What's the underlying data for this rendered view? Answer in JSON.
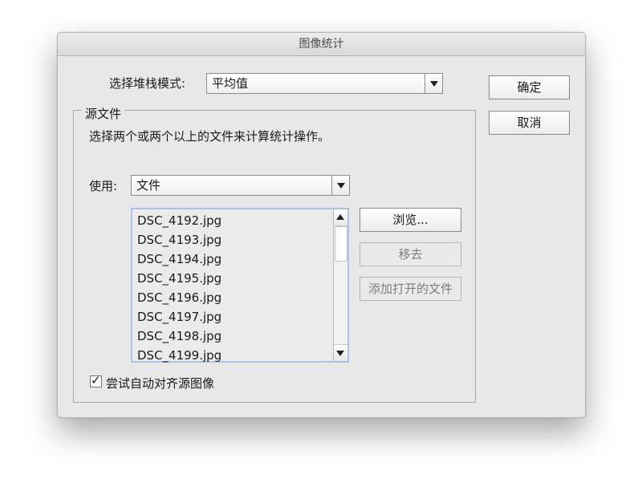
{
  "dialog": {
    "title": "图像统计",
    "stack_mode": {
      "label": "选择堆栈模式:",
      "value": "平均值"
    },
    "source": {
      "group_label": "源文件",
      "description": "选择两个或两个以上的文件来计算统计操作。",
      "use": {
        "label": "使用:",
        "value": "文件"
      },
      "files": [
        "DSC_4192.jpg",
        "DSC_4193.jpg",
        "DSC_4194.jpg",
        "DSC_4195.jpg",
        "DSC_4196.jpg",
        "DSC_4197.jpg",
        "DSC_4198.jpg",
        "DSC_4199.jpg"
      ],
      "buttons": {
        "browse": "浏览...",
        "remove": "移去",
        "add_open": "添加打开的文件"
      },
      "align": {
        "label": "尝试自动对齐源图像",
        "checked": true,
        "check_glyph": "✓"
      }
    },
    "buttons": {
      "ok": "确定",
      "cancel": "取消"
    }
  }
}
